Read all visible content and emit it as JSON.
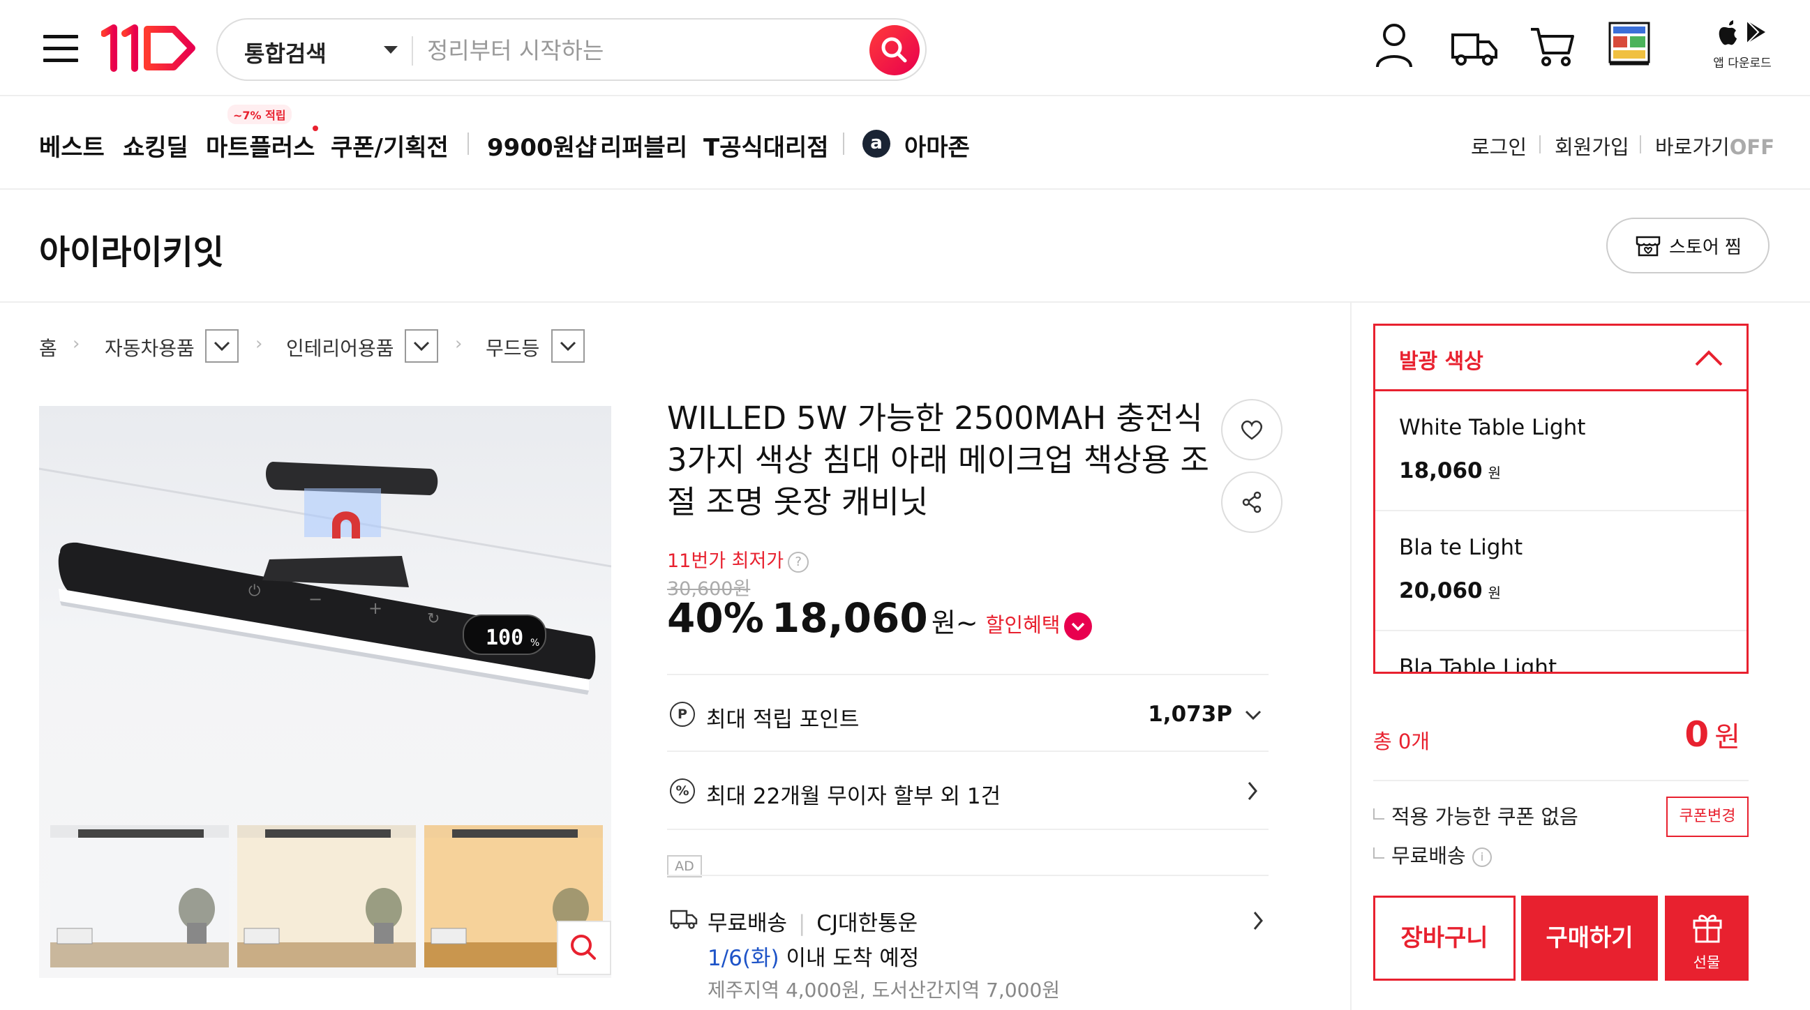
{
  "header": {
    "search": {
      "scope": "통합검색",
      "placeholder": "정리부터 시작하는"
    },
    "app_download": "앱 다운로드"
  },
  "nav": {
    "badge": "~7% 적립",
    "items": [
      "베스트",
      "쇼킹딜",
      "마트플러스",
      "쿠폰/기획전",
      "9900원샵",
      "리퍼블리",
      "T공식대리점",
      "아마존"
    ],
    "amazon_letter": "a",
    "right": {
      "login": "로그인",
      "signup": "회원가입",
      "shortcut": "바로가기",
      "shortcut_state": "OFF"
    }
  },
  "store": {
    "name": "아이라이키잇",
    "favorite_label": "스토어 찜"
  },
  "breadcrumb": [
    "홈",
    "자동차용품",
    "인테리어용품",
    "무드등"
  ],
  "product": {
    "title": "WILLED 5W 가능한 2500MAH 충전식 3가지 색상 침대 아래 메이크업 책상용 조절 조명 옷장 캐비닛",
    "lowest_label": "11번가 최저가",
    "question_mark": "?",
    "original_price": "30,600원",
    "discount_pct": "40%",
    "price": "18,060",
    "price_unit": "원~",
    "discount_benefit": "할인혜택",
    "display_digits": "100",
    "points": {
      "icon_letter": "P",
      "label": "최대 적립 포인트",
      "value": "1,073P"
    },
    "installment": {
      "icon_letter": "%",
      "label": "최대 22개월 무이자 할부 외 1건"
    },
    "ad": "AD",
    "shipping": {
      "label": "무료배송",
      "carrier": "CJ대한통운",
      "date": "1/6(화)",
      "arrival": "이내 도착 예정",
      "extra": "제주지역 4,000원, 도서산간지역 7,000원"
    }
  },
  "options": {
    "header": "발광 색상",
    "items": [
      {
        "name": "White Table Light",
        "price": "18,060",
        "unit": "원"
      },
      {
        "name": "Bla te Light",
        "price": "20,060",
        "unit": "원"
      },
      {
        "name": "Bla Table Light",
        "price": "",
        "unit": ""
      }
    ]
  },
  "order": {
    "total_label": "총 0개",
    "total_value": "0",
    "total_unit": "원",
    "coupon_status": "적용 가능한 쿠폰 없음",
    "coupon_button": "쿠폰변경",
    "delivery": "무료배송",
    "info_icon": "i",
    "cart_button": "장바구니",
    "buy_button": "구매하기",
    "gift_button": "선물"
  },
  "colors": {
    "brand_red": "#e8212f",
    "brand_pink": "#e8004e",
    "link_blue": "#1e54c8"
  },
  "icons": [
    "hamburger-icon",
    "logo-11st",
    "search-icon",
    "user-icon",
    "truck-icon",
    "cart-icon",
    "recent-item-thumb",
    "apple-icon",
    "play-icon",
    "store-icon",
    "heart-icon",
    "share-icon",
    "zoom-icon",
    "chevron-up-icon",
    "chevron-down-icon",
    "chevron-right-icon",
    "gift-icon"
  ]
}
